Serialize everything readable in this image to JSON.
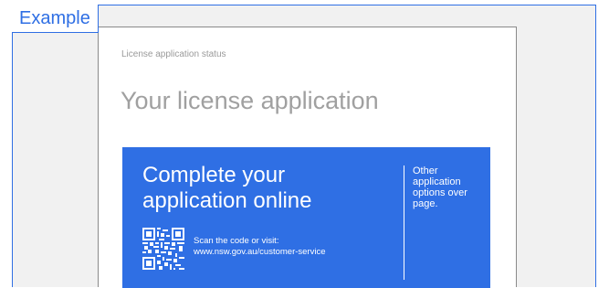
{
  "tab": {
    "label": "Example"
  },
  "document": {
    "eyebrow": "License application status",
    "heading": "Your license application"
  },
  "panel": {
    "title": "Complete your application online",
    "aside": "Other application options over page.",
    "scan_line1": "Scan the code or visit:",
    "scan_line2": "www.nsw.gov.au/customer-service",
    "qr_icon": "qr-code-icon"
  },
  "colors": {
    "accent": "#2f6fe4",
    "frame_bg": "#f1f1f1",
    "muted_text": "#a0a0a0"
  }
}
